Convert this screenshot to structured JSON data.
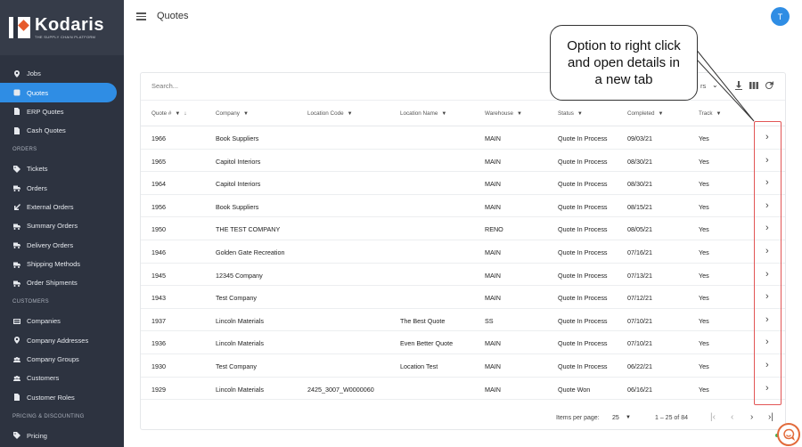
{
  "brand": {
    "name": "Kodaris",
    "tagline": "THE SUPPLY CHAIN PLATFORM"
  },
  "sidebar": {
    "items": [
      {
        "label": "Jobs",
        "icon": "map-pin-icon",
        "active": false
      },
      {
        "label": "Quotes",
        "icon": "quote-icon",
        "active": true
      },
      {
        "label": "ERP Quotes",
        "icon": "document-icon",
        "active": false
      },
      {
        "label": "Cash Quotes",
        "icon": "document-icon",
        "active": false
      }
    ],
    "sections": [
      {
        "title": "ORDERS",
        "items": [
          {
            "label": "Tickets",
            "icon": "tag-icon"
          },
          {
            "label": "Orders",
            "icon": "truck-icon"
          },
          {
            "label": "External Orders",
            "icon": "arrow-icon"
          },
          {
            "label": "Summary Orders",
            "icon": "truck-icon"
          },
          {
            "label": "Delivery Orders",
            "icon": "truck-icon"
          },
          {
            "label": "Shipping Methods",
            "icon": "truck-icon"
          },
          {
            "label": "Order Shipments",
            "icon": "truck-icon"
          }
        ]
      },
      {
        "title": "CUSTOMERS",
        "items": [
          {
            "label": "Companies",
            "icon": "building-icon"
          },
          {
            "label": "Company Addresses",
            "icon": "map-pin-icon"
          },
          {
            "label": "Company Groups",
            "icon": "group-icon"
          },
          {
            "label": "Customers",
            "icon": "group-icon"
          },
          {
            "label": "Customer Roles",
            "icon": "document-icon"
          }
        ]
      },
      {
        "title": "PRICING & DISCOUNTING",
        "items": [
          {
            "label": "Pricing",
            "icon": "tag-icon"
          }
        ]
      }
    ]
  },
  "header": {
    "title": "Quotes",
    "avatar_initial": "T"
  },
  "toolbar": {
    "search_placeholder": "Search...",
    "filters_label": "rs"
  },
  "table": {
    "columns": [
      {
        "label": "Quote #",
        "extra": "↓"
      },
      {
        "label": "Company"
      },
      {
        "label": "Location Code"
      },
      {
        "label": "Location Name"
      },
      {
        "label": "Warehouse"
      },
      {
        "label": "Status"
      },
      {
        "label": "Completed"
      },
      {
        "label": "Track"
      }
    ],
    "rows": [
      {
        "quote": "1966",
        "company": "Book Suppliers",
        "loc_code": "",
        "loc_name": "",
        "warehouse": "MAIN",
        "status": "Quote In Process",
        "completed": "09/03/21",
        "tracked": "Yes"
      },
      {
        "quote": "1965",
        "company": "Capitol Interiors",
        "loc_code": "",
        "loc_name": "",
        "warehouse": "MAIN",
        "status": "Quote In Process",
        "completed": "08/30/21",
        "tracked": "Yes"
      },
      {
        "quote": "1964",
        "company": "Capitol Interiors",
        "loc_code": "",
        "loc_name": "",
        "warehouse": "MAIN",
        "status": "Quote In Process",
        "completed": "08/30/21",
        "tracked": "Yes"
      },
      {
        "quote": "1956",
        "company": "Book Suppliers",
        "loc_code": "",
        "loc_name": "",
        "warehouse": "MAIN",
        "status": "Quote In Process",
        "completed": "08/15/21",
        "tracked": "Yes"
      },
      {
        "quote": "1950",
        "company": "THE TEST COMPANY",
        "loc_code": "",
        "loc_name": "",
        "warehouse": "RENO",
        "status": "Quote In Process",
        "completed": "08/05/21",
        "tracked": "Yes"
      },
      {
        "quote": "1946",
        "company": "Golden Gate Recreation",
        "loc_code": "",
        "loc_name": "",
        "warehouse": "MAIN",
        "status": "Quote In Process",
        "completed": "07/16/21",
        "tracked": "Yes"
      },
      {
        "quote": "1945",
        "company": "12345 Company",
        "loc_code": "",
        "loc_name": "",
        "warehouse": "MAIN",
        "status": "Quote In Process",
        "completed": "07/13/21",
        "tracked": "Yes"
      },
      {
        "quote": "1943",
        "company": "Test Company",
        "loc_code": "",
        "loc_name": "",
        "warehouse": "MAIN",
        "status": "Quote In Process",
        "completed": "07/12/21",
        "tracked": "Yes"
      },
      {
        "quote": "1937",
        "company": "Lincoln Materials",
        "loc_code": "",
        "loc_name": "The Best Quote",
        "warehouse": "SS",
        "status": "Quote In Process",
        "completed": "07/10/21",
        "tracked": "Yes"
      },
      {
        "quote": "1936",
        "company": "Lincoln Materials",
        "loc_code": "",
        "loc_name": "Even Better Quote",
        "warehouse": "MAIN",
        "status": "Quote In Process",
        "completed": "07/10/21",
        "tracked": "Yes"
      },
      {
        "quote": "1930",
        "company": "Test Company",
        "loc_code": "",
        "loc_name": "Location Test",
        "warehouse": "MAIN",
        "status": "Quote In Process",
        "completed": "06/22/21",
        "tracked": "Yes"
      },
      {
        "quote": "1929",
        "company": "Lincoln Materials",
        "loc_code": "2425_3007_W0000060",
        "loc_name": "",
        "warehouse": "MAIN",
        "status": "Quote Won",
        "completed": "06/16/21",
        "tracked": "Yes"
      }
    ]
  },
  "pagination": {
    "items_per_page_label": "Items per page:",
    "page_size": "25",
    "range": "1 – 25 of 84"
  },
  "callout": {
    "lines": [
      "Option to right click",
      "and open details in",
      "a new tab"
    ]
  },
  "colors": {
    "sidebar_bg": "#2d3340",
    "accent": "#2f8de4",
    "highlight_border": "#e25555",
    "help_ring": "#e26a3a"
  }
}
